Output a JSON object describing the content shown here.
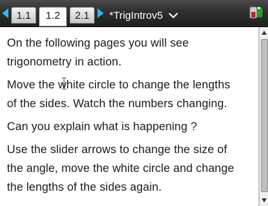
{
  "tabs": [
    {
      "label": "1.1",
      "active": false
    },
    {
      "label": "1.2",
      "active": true
    },
    {
      "label": "2.1",
      "active": false
    }
  ],
  "document": {
    "title": "*TrigIntrov5"
  },
  "content": {
    "paragraphs": [
      "On the following pages you will see trigonometry in action.",
      "Move the white circle to change the lengths of the sides. Watch the numbers changing.",
      "Can you explain what is happening ?",
      "Use the slider arrows to change the size of the angle, move the white circle and change the lengths of the sides again."
    ],
    "lines": [
      [
        "On the following pages you will see",
        "trigonometry in action."
      ],
      [
        "Move the white circle to change the lengths",
        "of the sides. Watch the numbers changing."
      ],
      [
        "Can you explain what is happening ?"
      ],
      [
        "Use the slider arrows to change the size of",
        "the angle, move the white circle and change",
        "the lengths of the sides again."
      ]
    ]
  },
  "icons": {
    "prev": "triangle-left-icon",
    "next": "triangle-right-icon",
    "menu": "chevron-down-icon",
    "battery": "battery-icon",
    "cursor": "text-cursor-icon"
  },
  "colors": {
    "accent": "#2fb3ff",
    "topbar": "#2e2e2e",
    "battery_fill": "#cc2222"
  }
}
